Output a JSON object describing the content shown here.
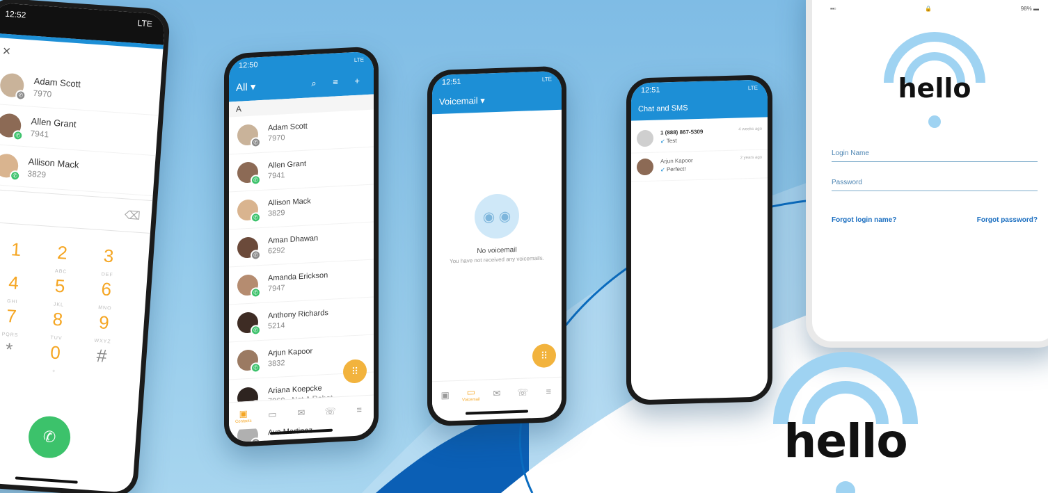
{
  "colors": {
    "accent": "#1d8fd6",
    "orange": "#f5a623",
    "green": "#3cc26b",
    "bg": "#8cc3e6"
  },
  "dialer": {
    "time": "12:52",
    "signal": "LTE",
    "close_icon": "×",
    "contacts": [
      {
        "name": "Adam Scott",
        "ext": "7970",
        "status": "grey"
      },
      {
        "name": "Allen Grant",
        "ext": "7941",
        "status": "green"
      },
      {
        "name": "Allison Mack",
        "ext": "3829",
        "status": "green"
      }
    ],
    "menu_icon": "⋮",
    "backspace_icon": "⌫",
    "keys": [
      {
        "d": "1",
        "l": ""
      },
      {
        "d": "2",
        "l": "ABC"
      },
      {
        "d": "3",
        "l": "DEF"
      },
      {
        "d": "4",
        "l": "GHI"
      },
      {
        "d": "5",
        "l": "JKL"
      },
      {
        "d": "6",
        "l": "MNO"
      },
      {
        "d": "7",
        "l": "PQRS"
      },
      {
        "d": "8",
        "l": "TUV"
      },
      {
        "d": "9",
        "l": "WXYZ"
      },
      {
        "d": "*",
        "l": ""
      },
      {
        "d": "0",
        "l": "+"
      },
      {
        "d": "#",
        "l": ""
      }
    ],
    "call_icon": "✆"
  },
  "contacts": {
    "time": "12:50",
    "signal": "LTE",
    "filter": "All ▾",
    "actions": "⌕ ≡ +",
    "section": "A",
    "list": [
      {
        "name": "Adam Scott",
        "ext": "7970",
        "status": "grey"
      },
      {
        "name": "Allen Grant",
        "ext": "7941",
        "status": "green"
      },
      {
        "name": "Allison Mack",
        "ext": "3829",
        "status": "green"
      },
      {
        "name": "Aman Dhawan",
        "ext": "6292",
        "status": "grey"
      },
      {
        "name": "Amanda Erickson",
        "ext": "7947",
        "status": "green"
      },
      {
        "name": "Anthony Richards",
        "ext": "5214",
        "status": "green"
      },
      {
        "name": "Arjun Kapoor",
        "ext": "3832",
        "status": "green"
      },
      {
        "name": "Ariana Koepcke",
        "ext": "7060 - Not A Robot",
        "status": "red"
      },
      {
        "name": "Ava Martinez",
        "ext": "",
        "status": "grey"
      }
    ],
    "tabs": [
      {
        "icon": "▣",
        "label": "Contacts",
        "on": true
      },
      {
        "icon": "▭",
        "label": ""
      },
      {
        "icon": "✉",
        "label": ""
      },
      {
        "icon": "☏",
        "label": ""
      },
      {
        "icon": "≡",
        "label": ""
      }
    ],
    "fab_icon": "⠿"
  },
  "voicemail": {
    "time": "12:51",
    "signal": "LTE",
    "title": "Voicemail ▾",
    "empty_icon": "◉ ◉",
    "empty_title": "No voicemail",
    "empty_sub": "You have not received any voicemails.",
    "tabs": [
      {
        "icon": "▣",
        "label": ""
      },
      {
        "icon": "▭",
        "label": "Voicemail",
        "on": true
      },
      {
        "icon": "✉",
        "label": ""
      },
      {
        "icon": "☏",
        "label": ""
      },
      {
        "icon": "≡",
        "label": ""
      }
    ],
    "fab_icon": "⠿"
  },
  "chat": {
    "time": "12:51",
    "signal": "LTE",
    "title": "Chat and SMS",
    "threads": [
      {
        "name": "1 (888) 867-5309",
        "msg": "Test",
        "time": "4 weeks ago",
        "bold": true
      },
      {
        "name": "Arjun Kapoor",
        "msg": "Perfect!",
        "time": "2 years ago",
        "bold": false
      }
    ]
  },
  "login": {
    "signal": "▪▪▫",
    "lock": "🔒",
    "battery": "98% ▬",
    "brand": "hello",
    "login_label": "Login Name",
    "password_label": "Password",
    "forgot_login": "Forgot login name?",
    "forgot_password": "Forgot password?"
  },
  "brand_big": "hello"
}
